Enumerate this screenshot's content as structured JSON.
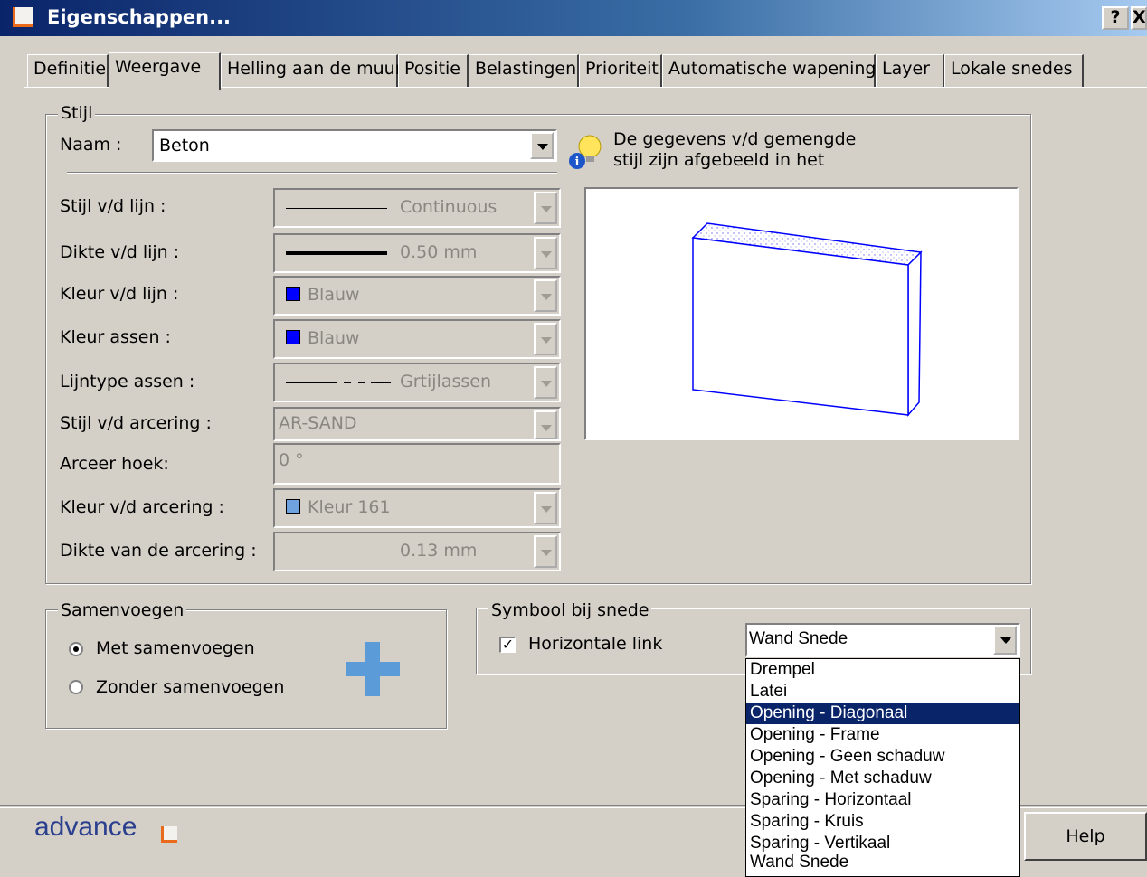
{
  "window": {
    "title": "Eigenschappen...",
    "help_btn": "?",
    "close_btn": "X"
  },
  "tabs": [
    {
      "label": "Definitie"
    },
    {
      "label": "Weergave",
      "active": true
    },
    {
      "label": "Helling aan de muur"
    },
    {
      "label": "Positie"
    },
    {
      "label": "Belastingen"
    },
    {
      "label": "Prioriteit"
    },
    {
      "label": "Automatische wapening"
    },
    {
      "label": "Layer"
    },
    {
      "label": "Lokale snedes"
    }
  ],
  "stijl": {
    "group_label": "Stijl",
    "naam_label": "Naam :",
    "naam_value": "Beton",
    "info_text_line1": "De gegevens v/d gemengde",
    "info_text_line2": "stijl zijn afgebeeld in het",
    "rows": [
      {
        "label": "Stijl v/d lijn :",
        "value": "Continuous"
      },
      {
        "label": "Dikte v/d lijn :",
        "value": "0.50 mm"
      },
      {
        "label": "Kleur v/d lijn :",
        "value": "Blauw",
        "color": "#0000ff"
      },
      {
        "label": "Kleur assen :",
        "value": "Blauw",
        "color": "#0000ff"
      },
      {
        "label": "Lijntype assen :",
        "value": "Grtijlassen"
      },
      {
        "label": "Stijl v/d arcering :",
        "value": "AR-SAND"
      },
      {
        "label": "Arceer hoek:",
        "value": "0 °"
      },
      {
        "label": "Kleur v/d arcering :",
        "value": "Kleur 161",
        "color": "#6fa3e0"
      },
      {
        "label": "Dikte van de arcering :",
        "value": "0.13 mm"
      }
    ]
  },
  "samenvoegen": {
    "group_label": "Samenvoegen",
    "option_met": "Met samenvoegen",
    "option_zonder": "Zonder samenvoegen",
    "selected": "met"
  },
  "symbool": {
    "group_label": "Symbool bij snede",
    "checkbox_label": "Horizontale link",
    "checked": true,
    "combo_value": "Wand Snede",
    "options": [
      "Drempel",
      "Latei",
      "Opening - Diagonaal",
      "Opening - Frame",
      "Opening - Geen schaduw",
      "Opening - Met schaduw",
      "Sparing - Horizontaal",
      "Sparing - Kruis",
      "Sparing - Vertikaal",
      "Wand Snede"
    ],
    "highlighted": "Opening - Diagonaal"
  },
  "footer": {
    "logo_text": "advance",
    "help_button": "Help"
  }
}
